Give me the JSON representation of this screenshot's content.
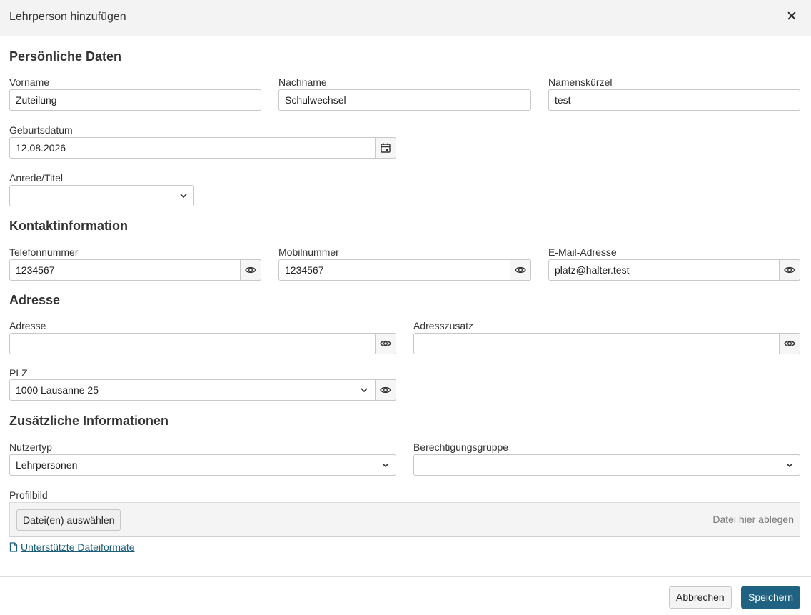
{
  "dialog": {
    "title": "Lehrperson hinzufügen",
    "close_icon": "close-icon"
  },
  "sections": {
    "personal": "Persönliche Daten",
    "contact": "Kontaktinformation",
    "address": "Adresse",
    "additional": "Zusätzliche Informationen"
  },
  "fields": {
    "vorname": {
      "label": "Vorname",
      "value": "Zuteilung"
    },
    "nachname": {
      "label": "Nachname",
      "value": "Schulwechsel"
    },
    "kuerzel": {
      "label": "Namenskürzel",
      "value": "test"
    },
    "geburtsdatum": {
      "label": "Geburtsdatum",
      "value": "12.08.2026"
    },
    "anrede": {
      "label": "Anrede/Titel",
      "value": ""
    },
    "telefon": {
      "label": "Telefonnummer",
      "value": "1234567"
    },
    "mobil": {
      "label": "Mobilnummer",
      "value": "1234567"
    },
    "email": {
      "label": "E-Mail-Adresse",
      "value": "platz@halter.test"
    },
    "adresse": {
      "label": "Adresse",
      "value": ""
    },
    "adresszusatz": {
      "label": "Adresszusatz",
      "value": ""
    },
    "plz": {
      "label": "PLZ",
      "value": "1000 Lausanne 25"
    },
    "nutzertyp": {
      "label": "Nutzertyp",
      "value": "Lehrpersonen"
    },
    "berechtigung": {
      "label": "Berechtigungsgruppe",
      "value": ""
    },
    "profilbild": {
      "label": "Profilbild"
    }
  },
  "upload": {
    "button_label": "Datei(en) auswählen",
    "drop_hint": "Datei hier ablegen",
    "formats_link": "Unterstützte Dateiformate"
  },
  "footer": {
    "cancel_label": "Abbrechen",
    "save_label": "Speichern"
  },
  "colors": {
    "primary": "#1f6281",
    "link": "#1d5f7a",
    "header_bg": "#f3f3f3"
  }
}
